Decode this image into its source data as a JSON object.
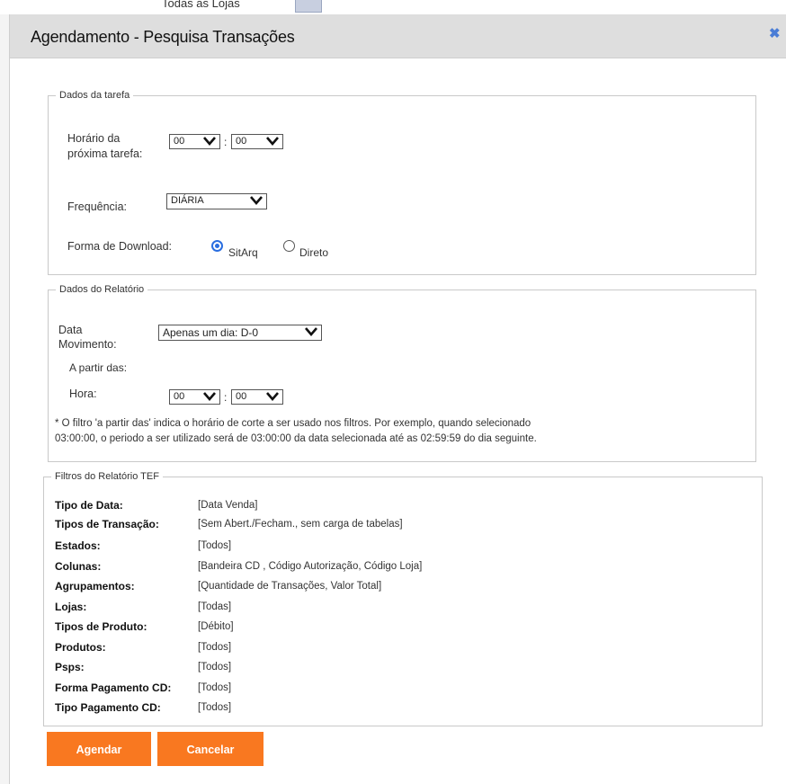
{
  "background": {
    "partial_text": "Todas as Lojas"
  },
  "dialog": {
    "title": "Agendamento - Pesquisa Transações",
    "close_icon": "close-icon",
    "accent_color": "#4a7dd6"
  },
  "tarefa": {
    "legend": "Dados da tarefa",
    "horario_label_1": "Horário da",
    "horario_label_2": "próxima tarefa:",
    "hour_value": "00",
    "minute_value": "00",
    "colon": ":",
    "frequencia_label": "Frequência:",
    "frequencia_value": "DIÁRIA",
    "download_label": "Forma de Download:",
    "download_options": [
      {
        "label": "SitArq",
        "selected": true
      },
      {
        "label": "Direto",
        "selected": false
      }
    ]
  },
  "relatorio": {
    "legend": "Dados do Relatório",
    "data_label_1": "Data",
    "data_label_2": "Movimento:",
    "data_value": "Apenas um dia: D-0",
    "a_partir_label": "A partir das:",
    "hora_label": "Hora:",
    "hour_value": "00",
    "minute_value": "00",
    "colon": ":",
    "note_1": "* O filtro 'a partir das' indica o horário de corte a ser usado nos filtros. Por exemplo, quando selecionado",
    "note_2": "03:00:00, o periodo a ser utilizado será de 03:00:00 da data selecionada até as 02:59:59 do dia seguinte."
  },
  "filtros": {
    "legend": "Filtros do Relatório TEF",
    "rows": [
      {
        "label": "Tipo de Data:",
        "value": "[Data Venda]"
      },
      {
        "label": "Tipos de Transação:",
        "value": "[Sem Abert./Fecham., sem carga de tabelas]"
      },
      {
        "label": "Estados:",
        "value": "[Todos]"
      },
      {
        "label": "Colunas:",
        "value": "[Bandeira CD , Código Autorização, Código Loja]"
      },
      {
        "label": "Agrupamentos:",
        "value": "[Quantidade de Transações, Valor Total]"
      },
      {
        "label": "Lojas:",
        "value": "[Todas]"
      },
      {
        "label": "Tipos de Produto:",
        "value": "[Débito]"
      },
      {
        "label": "Produtos:",
        "value": "[Todos]"
      },
      {
        "label": "Psps:",
        "value": "[Todos]"
      },
      {
        "label": "Forma Pagamento CD:",
        "value": "[Todos]"
      },
      {
        "label": "Tipo Pagamento CD:",
        "value": "[Todos]"
      }
    ]
  },
  "actions": {
    "agendar_label": "Agendar",
    "cancelar_label": "Cancelar",
    "button_color": "#f97820"
  }
}
